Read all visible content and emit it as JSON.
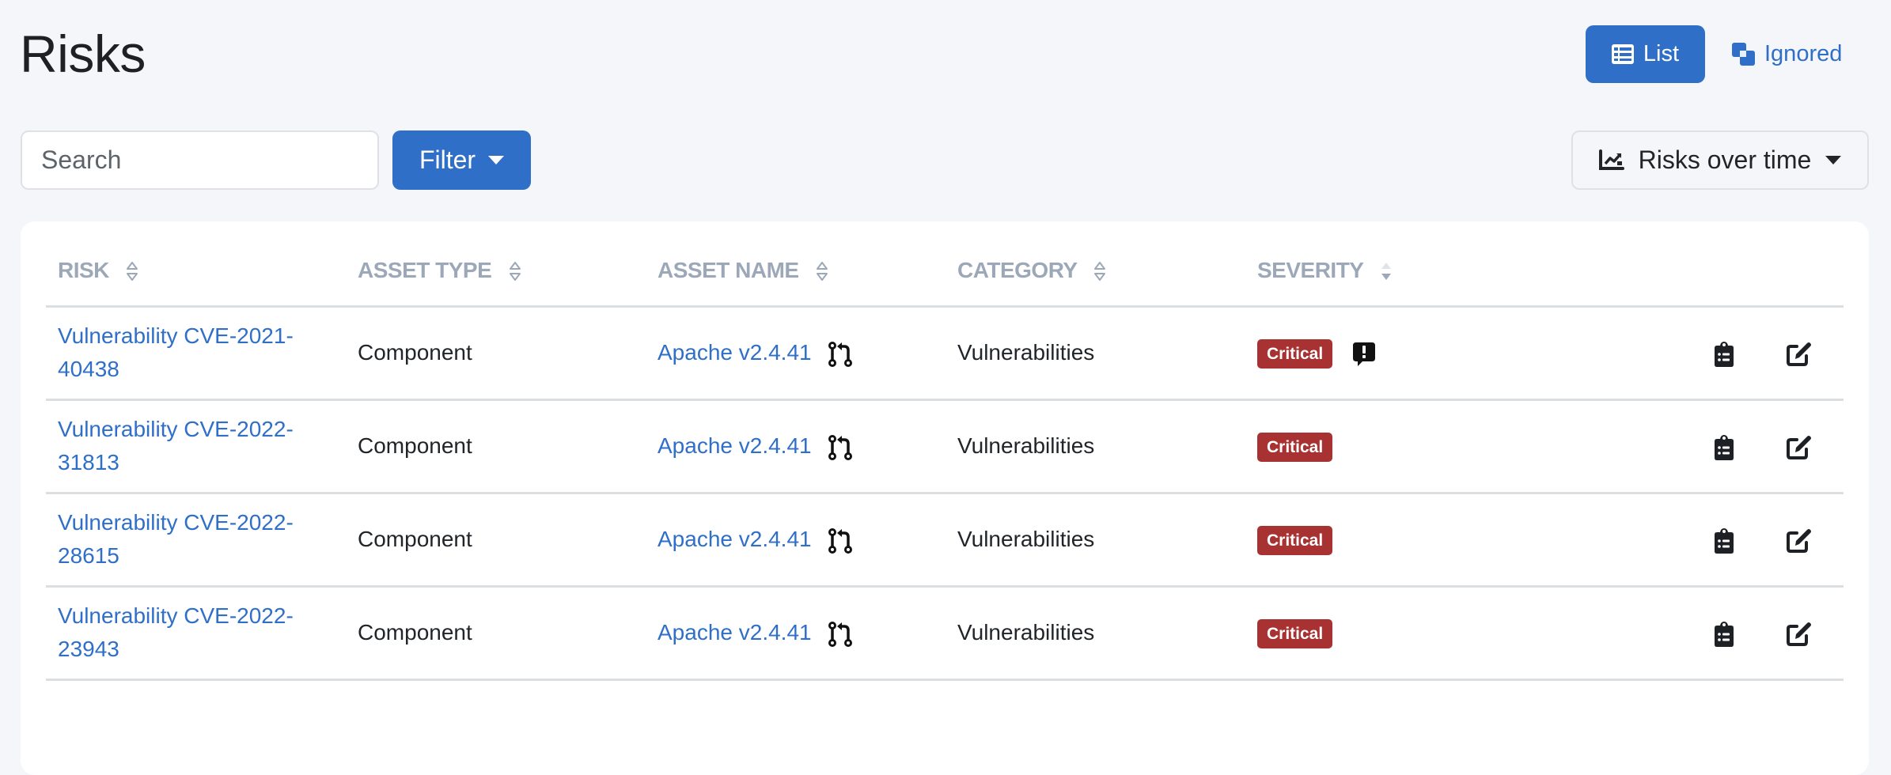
{
  "page": {
    "title": "Risks"
  },
  "view_switch": {
    "list_label": "List",
    "ignored_label": "Ignored",
    "active": "List"
  },
  "toolbar": {
    "search_placeholder": "Search",
    "search_value": "",
    "filter_label": "Filter",
    "chart_label": "Risks over time"
  },
  "table": {
    "columns": [
      {
        "label": "RISK",
        "sort": "none"
      },
      {
        "label": "ASSET TYPE",
        "sort": "none"
      },
      {
        "label": "ASSET NAME",
        "sort": "none"
      },
      {
        "label": "CATEGORY",
        "sort": "none"
      },
      {
        "label": "SEVERITY",
        "sort": "descending"
      }
    ],
    "rows": [
      {
        "risk": "Vulnerability CVE-2021-40438",
        "asset_type": "Component",
        "asset_name": "Apache v2.4.41",
        "asset_icon": "code-pull-request-icon",
        "category": "Vulnerabilities",
        "severity": "Critical",
        "has_comment": true
      },
      {
        "risk": "Vulnerability CVE-2022-31813",
        "asset_type": "Component",
        "asset_name": "Apache v2.4.41",
        "asset_icon": "code-pull-request-icon",
        "category": "Vulnerabilities",
        "severity": "Critical",
        "has_comment": false
      },
      {
        "risk": "Vulnerability CVE-2022-28615",
        "asset_type": "Component",
        "asset_name": "Apache v2.4.41",
        "asset_icon": "code-pull-request-icon",
        "category": "Vulnerabilities",
        "severity": "Critical",
        "has_comment": false
      },
      {
        "risk": "Vulnerability CVE-2022-23943",
        "asset_type": "Component",
        "asset_name": "Apache v2.4.41",
        "asset_icon": "code-pull-request-icon",
        "category": "Vulnerabilities",
        "severity": "Critical",
        "has_comment": false
      }
    ]
  },
  "colors": {
    "primary": "#2f6fc8",
    "critical": "#a83232",
    "header_text": "#9ca8b8",
    "background": "#f4f6f9"
  }
}
